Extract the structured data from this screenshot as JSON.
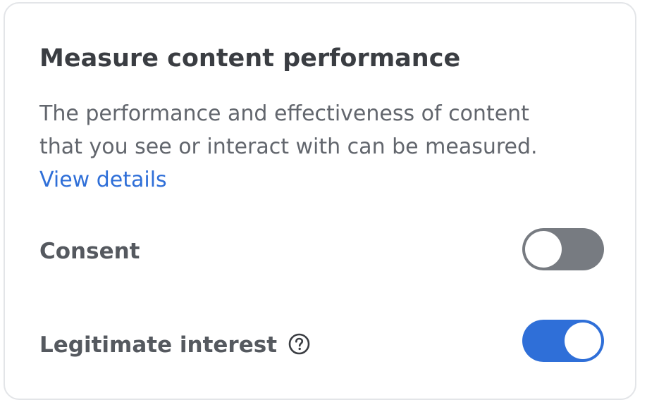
{
  "card": {
    "title": "Measure content performance",
    "description_lines": [
      "The performance and effectiveness of content",
      "that you see or interact with can be measured."
    ],
    "details_link": "View details"
  },
  "rows": [
    {
      "label": "Consent",
      "toggle_state": "off"
    },
    {
      "label": "Legitimate interest",
      "toggle_state": "on",
      "icon": "help-circle-icon"
    }
  ],
  "colors": {
    "accent": "#2f6fd8",
    "toggle_off": "#777b81",
    "title_text": "#3a3d42",
    "body_text": "#62666d",
    "border": "#e3e5e8"
  }
}
